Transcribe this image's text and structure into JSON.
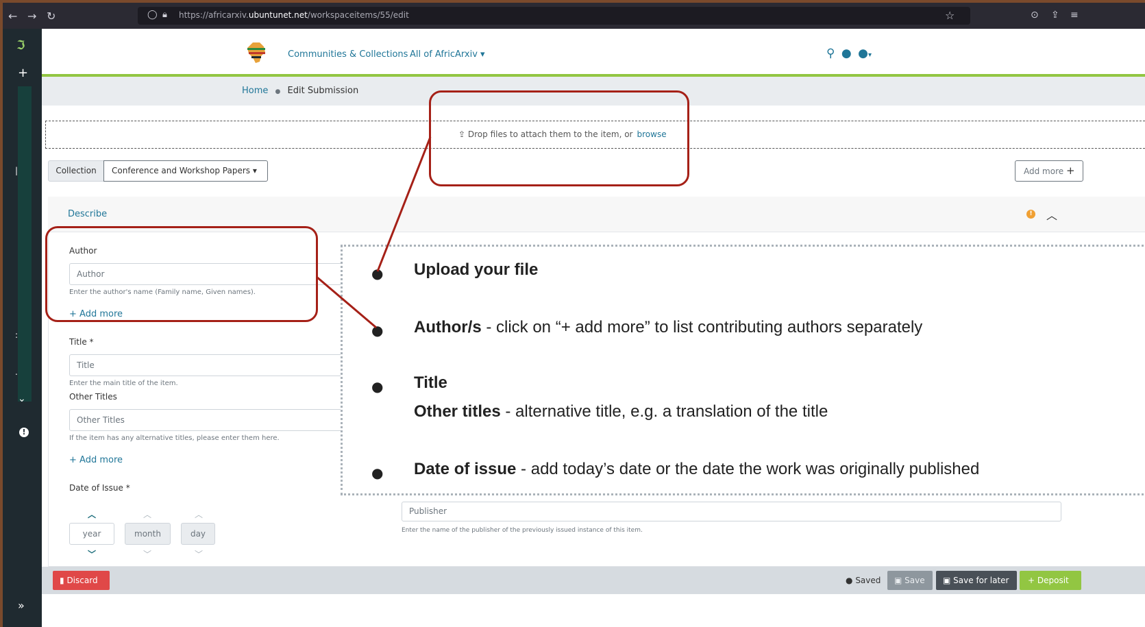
{
  "browser": {
    "url_prefix": "https://africarxiv.",
    "url_domain": "ubuntunet.net",
    "url_path": "/workspaceitems/55/edit"
  },
  "header": {
    "logo_text": "AfricArXiv",
    "nav_communities": "Communities & Collections",
    "nav_all": "All of AfricArxiv"
  },
  "breadcrumb": {
    "home": "Home",
    "current": "Edit Submission"
  },
  "dropzone": {
    "text": "Drop files to attach them to the item, or",
    "browse": "browse"
  },
  "collection": {
    "label": "Collection",
    "selected": "Conference and Workshop Papers"
  },
  "toolbar": {
    "add_more": "Add more"
  },
  "describe": {
    "title": "Describe",
    "author_label": "Author",
    "author_placeholder": "Author",
    "author_hint": "Enter the author's name (Family name, Given names).",
    "add_more": "Add more",
    "title_label": "Title *",
    "title_placeholder": "Title",
    "title_hint": "Enter the main title of the item.",
    "other_titles_label": "Other Titles",
    "other_titles_placeholder": "Other Titles",
    "other_titles_hint": "If the item has any alternative titles, please enter them here.",
    "date_label": "Date of Issue *",
    "year": "year",
    "month": "month",
    "day": "day",
    "publisher_placeholder": "Publisher",
    "publisher_hint": "Enter the name of the publisher of the previously issued instance of this item."
  },
  "actions": {
    "discard": "Discard",
    "saved": "Saved",
    "save": "Save",
    "save_later": "Save for later",
    "deposit": "Deposit"
  },
  "callouts": {
    "upload": "Upload your file",
    "authors_bold": "Author/s",
    "authors_rest": " - click on “+ add more” to list contributing authors separately",
    "title_bold": "Title",
    "other_titles_bold": "Other titles",
    "other_titles_rest": " - alternative title, e.g. a translation of the title",
    "date_bold": "Date of issue",
    "date_rest": " -  add today’s date or the date the work was originally published"
  },
  "colors": {
    "accent": "#207698",
    "brand_green": "#92c642",
    "callout_red": "#a52017",
    "danger": "#e04848"
  }
}
